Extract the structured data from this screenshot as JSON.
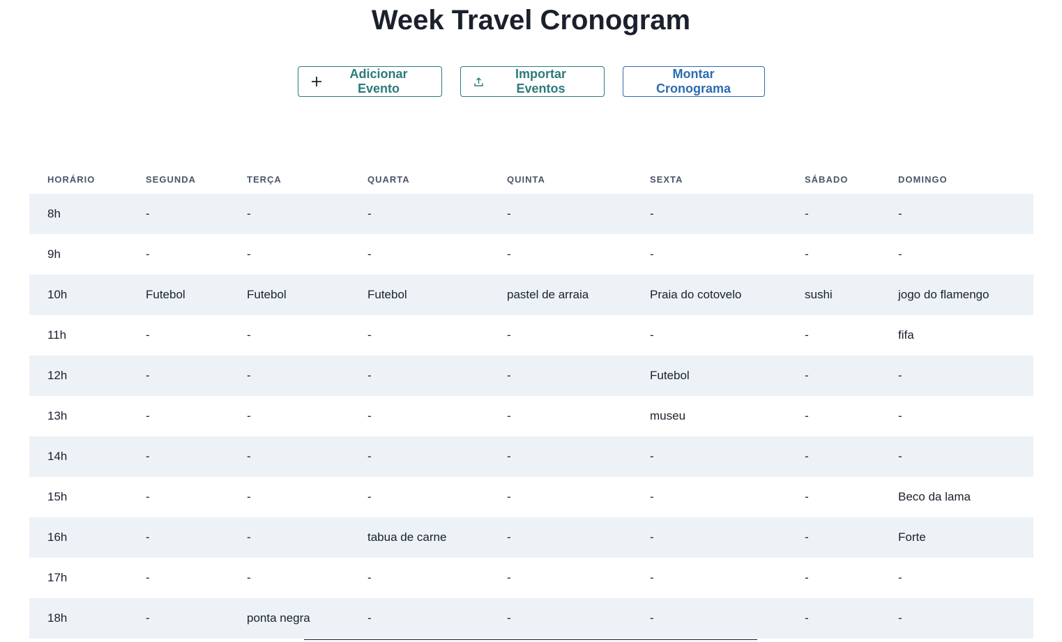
{
  "title": "Week Travel Cronogram",
  "actions": {
    "add_label": "Adicionar Evento",
    "import_label": "Importar Eventos",
    "build_label": "Montar Cronograma"
  },
  "colors": {
    "teal": "#2c7a7b",
    "blue": "#2b6cb0",
    "stripe": "#edf2f7"
  },
  "icons": {
    "add": "plus-icon",
    "import": "upload-icon"
  },
  "table": {
    "headers": [
      "HORÁRIO",
      "SEGUNDA",
      "TERÇA",
      "QUARTA",
      "QUINTA",
      "SEXTA",
      "SÁBADO",
      "DOMINGO"
    ],
    "rows": [
      [
        "8h",
        "-",
        "-",
        "-",
        "-",
        "-",
        "-",
        "-"
      ],
      [
        "9h",
        "-",
        "-",
        "-",
        "-",
        "-",
        "-",
        "-"
      ],
      [
        "10h",
        "Futebol",
        "Futebol",
        "Futebol",
        "pastel de arraia",
        "Praia do cotovelo",
        "sushi",
        "jogo do flamengo"
      ],
      [
        "11h",
        "-",
        "-",
        "-",
        "-",
        "-",
        "-",
        "fifa"
      ],
      [
        "12h",
        "-",
        "-",
        "-",
        "-",
        "Futebol",
        "-",
        "-"
      ],
      [
        "13h",
        "-",
        "-",
        "-",
        "-",
        "museu",
        "-",
        "-"
      ],
      [
        "14h",
        "-",
        "-",
        "-",
        "-",
        "-",
        "-",
        "-"
      ],
      [
        "15h",
        "-",
        "-",
        "-",
        "-",
        "-",
        "-",
        "Beco da lama"
      ],
      [
        "16h",
        "-",
        "-",
        "tabua de carne",
        "-",
        "-",
        "-",
        "Forte"
      ],
      [
        "17h",
        "-",
        "-",
        "-",
        "-",
        "-",
        "-",
        "-"
      ],
      [
        "18h",
        "-",
        "ponta negra",
        "-",
        "-",
        "-",
        "-",
        "-"
      ]
    ]
  }
}
